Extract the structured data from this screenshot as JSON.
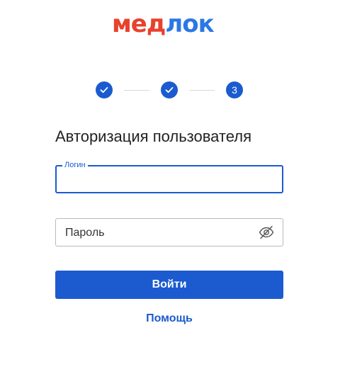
{
  "brand": {
    "logo_part1": "мед",
    "logo_part2": "лок",
    "colors": {
      "part1": "#e8412c",
      "part2": "#2b78e4"
    }
  },
  "stepper": {
    "steps": [
      {
        "state": "completed",
        "icon": "check-icon"
      },
      {
        "state": "completed",
        "icon": "check-icon"
      },
      {
        "state": "current",
        "label": "3"
      }
    ],
    "accent": "#1b5bcf"
  },
  "form": {
    "title": "Авторизация пользователя",
    "login": {
      "label": "Логин",
      "value": ""
    },
    "password": {
      "placeholder": "Пароль",
      "value": "",
      "toggle_icon": "eye-off-icon"
    },
    "submit_label": "Войти",
    "help_label": "Помощь"
  }
}
